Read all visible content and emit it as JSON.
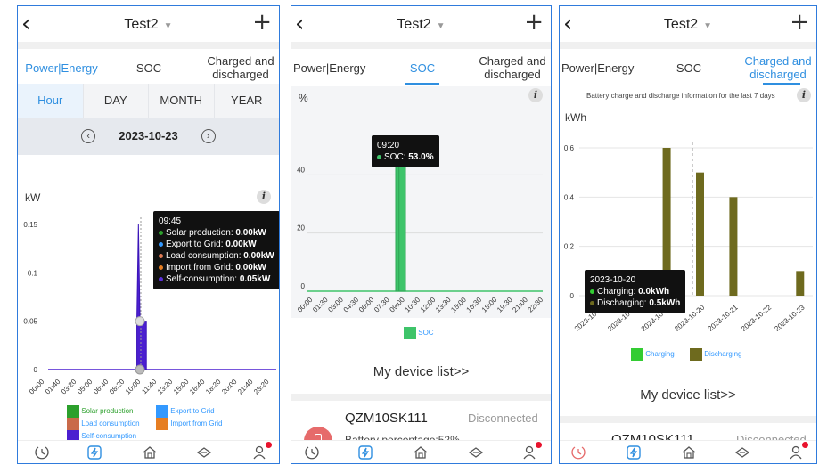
{
  "header": {
    "title": "Test2"
  },
  "tabs": {
    "power": "Power|Energy",
    "soc": "SOC",
    "charged": "Charged and discharged"
  },
  "panel1": {
    "segments": [
      "Hour",
      "DAY",
      "MONTH",
      "YEAR"
    ],
    "date": "2023-10-23",
    "unit": "kW",
    "tooltip": {
      "time": "09:45",
      "lines": [
        {
          "label": "Solar production: ",
          "value": "0.00kW",
          "color": "#2ca02c"
        },
        {
          "label": "Export to Grid: ",
          "value": "0.00kW",
          "color": "#3399ff"
        },
        {
          "label": "Load consumption: ",
          "value": "0.00kW",
          "color": "#e07b54"
        },
        {
          "label": "Import from Grid: ",
          "value": "0.00kW",
          "color": "#e67e22"
        },
        {
          "label": "Self-consumption: ",
          "value": "0.05kW",
          "color": "#5a2fd8"
        }
      ]
    },
    "legend": {
      "solar": "Solar production",
      "export": "Export to Grid",
      "load": "Load consumption",
      "import": "Import from Grid",
      "self": "Self-consumption"
    }
  },
  "panel2": {
    "unit": "%",
    "tooltip": {
      "time": "09:20",
      "label": "SOC: ",
      "value": "53.0%"
    },
    "legend": "SOC",
    "devlink": "My device list>>",
    "device": {
      "name": "QZM10SK111",
      "status": "Disconnected",
      "battery": "Battery percentage:52%"
    }
  },
  "panel3": {
    "caption": "Battery charge and discharge information for the last 7 days",
    "unit": "kWh",
    "tooltip": {
      "date": "2023-10-20",
      "charging_label": "Charging: ",
      "charging": "0.0kWh",
      "discharging_label": "Discharging: ",
      "discharging": "0.5kWh"
    },
    "legend": {
      "charging": "Charging",
      "discharging": "Discharging"
    },
    "devlink": "My device list>>",
    "device": {
      "name": "QZM10SK111",
      "status": "Disconnected"
    }
  },
  "chart_data": [
    {
      "type": "area",
      "title": "",
      "ylabel": "kW",
      "ylim": [
        0,
        0.15
      ],
      "yticks": [
        0,
        0.05,
        0.1,
        0.15
      ],
      "x": [
        "00:00",
        "01:40",
        "03:20",
        "05:00",
        "06:40",
        "08:20",
        "10:00",
        "11:40",
        "13:20",
        "15:00",
        "16:40",
        "18:20",
        "20:00",
        "21:40",
        "23:20"
      ],
      "series": [
        {
          "name": "Self-consumption",
          "points": [
            [
              "09:20",
              0.05
            ],
            [
              "09:30",
              0.15
            ],
            [
              "09:40",
              0.05
            ],
            [
              "10:20",
              0.05
            ]
          ]
        }
      ]
    },
    {
      "type": "bar",
      "ylabel": "%",
      "ylim": [
        0,
        60
      ],
      "yticks": [
        0,
        20,
        40
      ],
      "x": [
        "00:00",
        "01:30",
        "03:00",
        "04:30",
        "06:00",
        "07:30",
        "09:00",
        "10:30",
        "12:00",
        "13:30",
        "15:00",
        "16:30",
        "18:00",
        "19:30",
        "21:00",
        "22:30"
      ],
      "series": [
        {
          "name": "SOC",
          "points": [
            [
              "09:00",
              53
            ],
            [
              "09:20",
              53
            ],
            [
              "10:00",
              53
            ]
          ]
        }
      ]
    },
    {
      "type": "bar",
      "ylabel": "kWh",
      "ylim": [
        0,
        0.6
      ],
      "yticks": [
        0,
        0.2,
        0.4,
        0.6
      ],
      "categories": [
        "2023-10-17",
        "2023-10-18",
        "2023-10-19",
        "2023-10-20",
        "2023-10-21",
        "2023-10-22",
        "2023-10-23"
      ],
      "series": [
        {
          "name": "Charging",
          "values": [
            0,
            0,
            0,
            0,
            0,
            0,
            0
          ]
        },
        {
          "name": "Discharging",
          "values": [
            0,
            0.1,
            0.6,
            0.5,
            0.4,
            0,
            0.1
          ]
        }
      ]
    }
  ],
  "colors": {
    "accent": "#2f8fe0",
    "solar": "#2ca02c",
    "export": "#3399ff",
    "load": "#c96a4a",
    "import": "#e67e22",
    "self": "#4b1fd0",
    "soc": "#3ec46a",
    "charging": "#33cc33",
    "discharging": "#6e6a1e"
  }
}
